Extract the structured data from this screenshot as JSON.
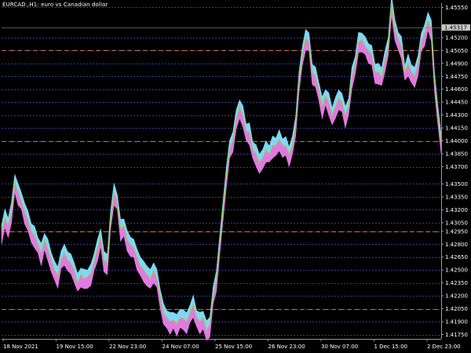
{
  "window": {
    "title": "EURCAD.,H1:  euro vs Canadian dollar"
  },
  "colors": {
    "background": "#000000",
    "grid_blue": "#3a3a9a",
    "grid_orange": "#c87a2a",
    "upper_band": "#7fd7f5",
    "lower_band": "#e07ae0",
    "price_line": "#9ad04a",
    "text": "#ffffff",
    "axis": "#9a9a9a"
  },
  "chart_data": {
    "type": "area",
    "symbol": "EURCAD.",
    "timeframe": "H1",
    "current_price": "1.45317",
    "y_ticks": [
      "1.45550",
      "1.45200",
      "1.45050",
      "1.44900",
      "1.44750",
      "1.44600",
      "1.44450",
      "1.44300",
      "1.44150",
      "1.44000",
      "1.43850",
      "1.43700",
      "1.43500",
      "1.43350",
      "1.43200",
      "1.43050",
      "1.42950",
      "1.42800",
      "1.42650",
      "1.42500",
      "1.42350",
      "1.42200",
      "1.42050",
      "1.41900",
      "1.41750"
    ],
    "y_tick_values": [
      1.4555,
      1.452,
      1.4505,
      1.449,
      1.4475,
      1.446,
      1.4445,
      1.443,
      1.4415,
      1.44,
      1.4385,
      1.437,
      1.435,
      1.4335,
      1.432,
      1.4305,
      1.4295,
      1.428,
      1.4265,
      1.425,
      1.4235,
      1.422,
      1.4205,
      1.419,
      1.4175
    ],
    "orange_levels": [
      1.4505,
      1.44,
      1.4295,
      1.4205
    ],
    "x_ticks": [
      "18 Nov 2021",
      "19 Nov 15:00",
      "22 Nov 23:00",
      "24 Nov 07:00",
      "25 Nov 15:00",
      "26 Nov 23:00",
      "30 Nov 07:00",
      "1 Dec 15:00",
      "2 Dec 23:00"
    ],
    "ylim": [
      1.417,
      1.456
    ],
    "series": [
      {
        "values": [
          1.4295,
          1.431,
          1.4302,
          1.4318,
          1.4352,
          1.434,
          1.433,
          1.4318,
          1.4308,
          1.4295,
          1.429,
          1.428,
          1.427,
          1.4285,
          1.4275,
          1.4262,
          1.425,
          1.4244,
          1.4262,
          1.427,
          1.4262,
          1.4258,
          1.425,
          1.4235,
          1.4245,
          1.424,
          1.4242,
          1.4246,
          1.426,
          1.4275,
          1.4288,
          1.4262,
          1.4258,
          1.431,
          1.434,
          1.433,
          1.4298,
          1.4302,
          1.4285,
          1.428,
          1.4275,
          1.4265,
          1.4255,
          1.425,
          1.4245,
          1.424,
          1.425,
          1.424,
          1.422,
          1.42,
          1.4195,
          1.419,
          1.4192,
          1.4188,
          1.4195,
          1.4194,
          1.419,
          1.42,
          1.421,
          1.4195,
          1.419,
          1.4195,
          1.418,
          1.4187,
          1.422,
          1.424,
          1.428,
          1.432,
          1.436,
          1.439,
          1.4402,
          1.4425,
          1.444,
          1.443,
          1.4412,
          1.441,
          1.439,
          1.4385,
          1.4375,
          1.438,
          1.439,
          1.4385,
          1.4395,
          1.4395,
          1.4402,
          1.4395,
          1.4394,
          1.4385,
          1.4395,
          1.442,
          1.447,
          1.45,
          1.452,
          1.4515,
          1.448,
          1.4475,
          1.446,
          1.444,
          1.4452,
          1.4445,
          1.443,
          1.444,
          1.445,
          1.4445,
          1.443,
          1.444,
          1.4475,
          1.449,
          1.4515,
          1.4518,
          1.451,
          1.4505,
          1.45,
          1.448,
          1.448,
          1.4475,
          1.4495,
          1.451,
          1.456,
          1.453,
          1.4518,
          1.451,
          1.448,
          1.449,
          1.448,
          1.4475,
          1.449,
          1.4515,
          1.4525,
          1.454,
          1.453,
          1.447,
          1.443,
          1.44
        ]
      }
    ]
  }
}
